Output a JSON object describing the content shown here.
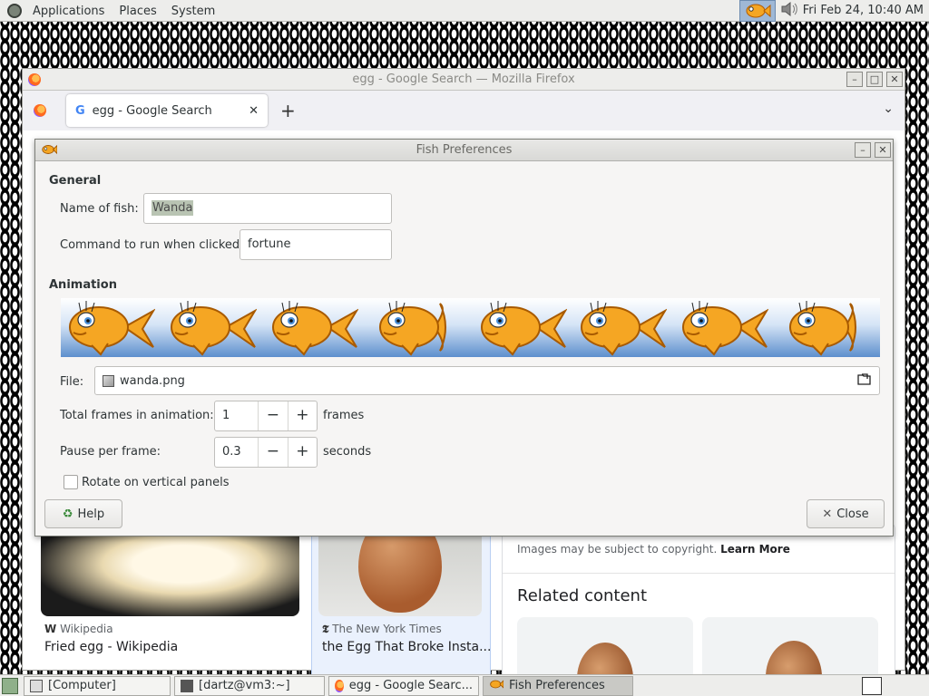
{
  "top_panel": {
    "menus": [
      "Applications",
      "Places",
      "System"
    ],
    "clock": "Fri Feb 24, 10:40 AM"
  },
  "firefox": {
    "window_title": "egg - Google Search — Mozilla Firefox",
    "tab_title": "egg - Google Search",
    "tab_favicon": "G",
    "page": {
      "card1_source": "Wikipedia",
      "card1_caption": "Fried egg - Wikipedia",
      "card2_source": "The New York Times",
      "card2_caption": "the Egg That Broke Insta...",
      "copyright_text": "Images may be subject to copyright.",
      "learn_more": "Learn More",
      "related_heading": "Related content"
    }
  },
  "dialog": {
    "title": "Fish Preferences",
    "general_label": "General",
    "name_label": "Name of fish:",
    "name_value": "Wanda",
    "command_label": "Command to run when clicked:",
    "command_value": "fortune",
    "animation_label": "Animation",
    "file_label": "File:",
    "file_value": "wanda.png",
    "frames_label": "Total frames in animation:",
    "frames_value": "1",
    "frames_unit": "frames",
    "pause_label": "Pause per frame:",
    "pause_value": "0.3",
    "pause_unit": "seconds",
    "rotate_label": "Rotate on vertical panels",
    "rotate_checked": false,
    "help_button": "Help",
    "close_button": "Close",
    "decrement": "−",
    "increment": "+"
  },
  "taskbar": {
    "items": [
      "[Computer]",
      "[dartz@vm3:~]",
      "egg - Google Searc...",
      "Fish Preferences"
    ]
  },
  "colors": {
    "panel_bg": "#ededeb",
    "dialog_bg": "#f6f5f4",
    "selection": "#b9c4b3",
    "fish_orange": "#f5a623"
  }
}
